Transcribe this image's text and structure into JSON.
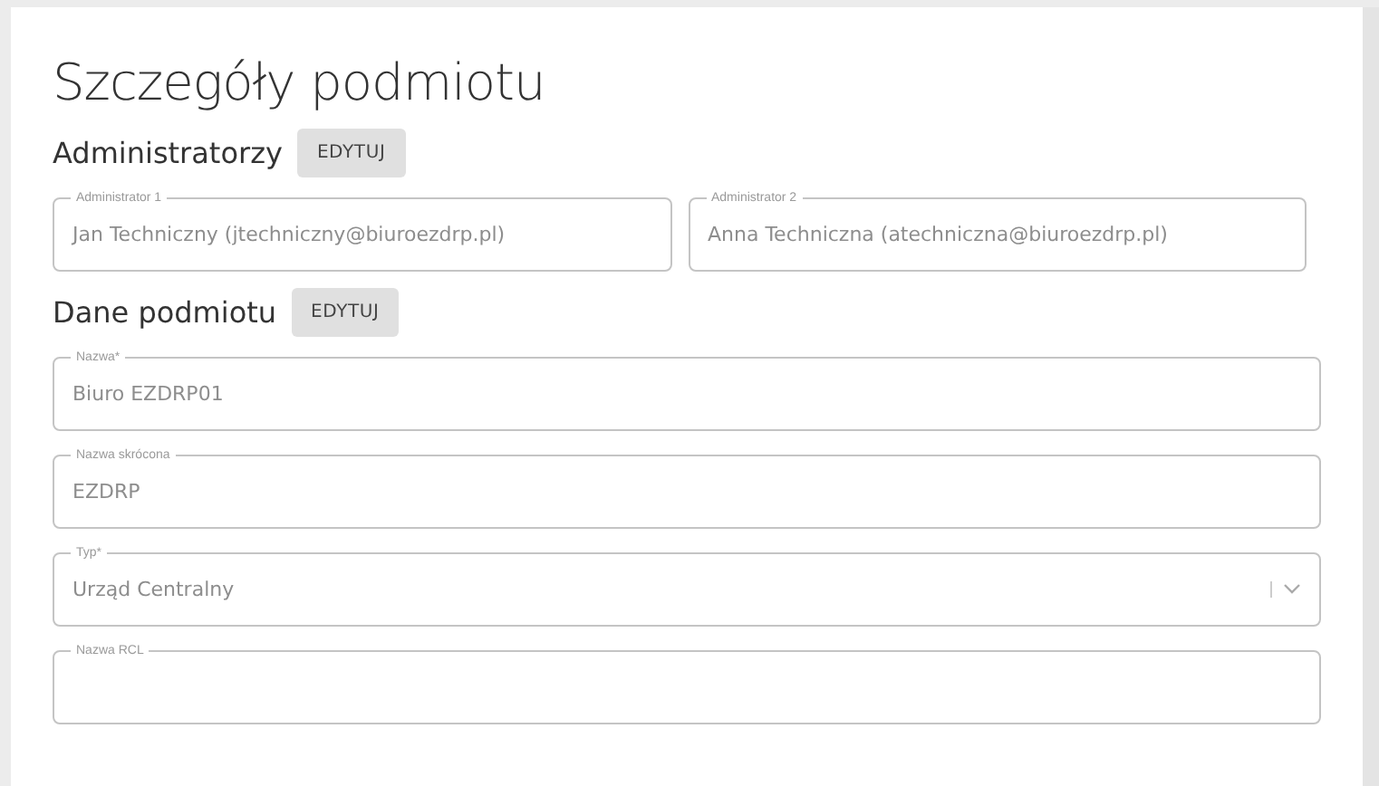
{
  "title": "Szczegóły podmiotu",
  "sections": [
    {
      "heading": "Administratorzy",
      "button": "EDYTUJ",
      "kind": "pair",
      "fields": [
        {
          "kind": "text",
          "label": "Administrator 1",
          "value": "Jan Techniczny (jtechniczny@biuroezdrp.pl)",
          "disabled": true
        },
        {
          "kind": "text",
          "label": "Administrator 2",
          "value": "Anna Techniczna (atechniczna@biuroezdrp.pl)",
          "disabled": true
        }
      ]
    },
    {
      "heading": "Dane podmiotu",
      "button": "EDYTUJ",
      "kind": "stack",
      "fields": [
        {
          "kind": "text",
          "label": "Nazwa*",
          "value": "Biuro EZDRP01",
          "disabled": true
        },
        {
          "kind": "text",
          "label": "Nazwa skrócona",
          "value": "EZDRP",
          "disabled": true
        },
        {
          "kind": "select",
          "label": "Typ*",
          "value": "Urząd Centralny",
          "disabled": true
        },
        {
          "kind": "text",
          "label": "Nazwa RCL",
          "disabled": true
        }
      ]
    }
  ]
}
